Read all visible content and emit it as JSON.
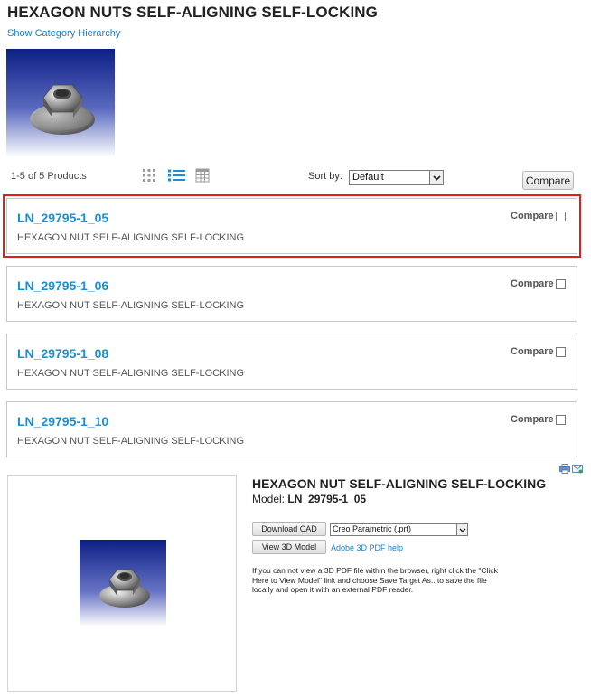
{
  "header": {
    "title": "HEXAGON NUTS SELF-ALIGNING SELF-LOCKING",
    "hierarchy_link": "Show Category Hierarchy"
  },
  "toolbar": {
    "count_text": "1-5 of 5 Products",
    "views": [
      "grid-view-icon",
      "list-view-icon",
      "table-view-icon"
    ],
    "active_view": "list",
    "sort_label": "Sort by:",
    "sort_value": "Default",
    "compare_button": "Compare"
  },
  "products": [
    {
      "title": "LN_29795-1_05",
      "description": "HEXAGON NUT SELF-ALIGNING SELF-LOCKING",
      "compare_label": "Compare",
      "selected": true
    },
    {
      "title": "LN_29795-1_06",
      "description": "HEXAGON NUT SELF-ALIGNING SELF-LOCKING",
      "compare_label": "Compare",
      "selected": false
    },
    {
      "title": "LN_29795-1_08",
      "description": "HEXAGON NUT SELF-ALIGNING SELF-LOCKING",
      "compare_label": "Compare",
      "selected": false
    },
    {
      "title": "LN_29795-1_10",
      "description": "HEXAGON NUT SELF-ALIGNING SELF-LOCKING",
      "compare_label": "Compare",
      "selected": false
    }
  ],
  "detail": {
    "title": "HEXAGON NUT SELF-ALIGNING SELF-LOCKING",
    "model_label": "Model:",
    "model_value": "LN_29795-1_05",
    "download_button": "Download CAD",
    "format_value": "Creo Parametric (.prt)",
    "view3d_button": "View 3D Model",
    "pdf_help_link": "Adobe 3D PDF help",
    "note": "If you can not view a 3D PDF file within the browser, right click the \"Click Here to View Model\" link and choose Save Target As.. to save the file locally and open it with an external PDF reader.",
    "tools": [
      "print-icon",
      "email-icon"
    ]
  },
  "colors": {
    "link_blue": "#1a8fd8",
    "highlight_red": "#e01e1e",
    "card_border": "#c8c8c8",
    "image_gradient_top": "#0c1f86",
    "image_gradient_bottom": "#ffffff"
  }
}
